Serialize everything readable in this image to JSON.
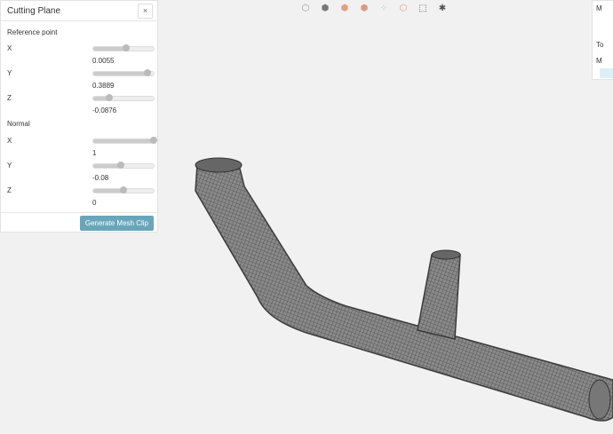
{
  "panel": {
    "title": "Cutting Plane",
    "close": "×",
    "reference_label": "Reference point",
    "reference": [
      {
        "axis": "X",
        "value": "0.0055",
        "pct": 55
      },
      {
        "axis": "Y",
        "value": "0.3889",
        "pct": 90
      },
      {
        "axis": "Z",
        "value": "-0.0876",
        "pct": 27
      }
    ],
    "normal_label": "Normal",
    "normal": [
      {
        "axis": "X",
        "value": "1",
        "pct": 100
      },
      {
        "axis": "Y",
        "value": "-0.08",
        "pct": 46
      },
      {
        "axis": "Z",
        "value": "0",
        "pct": 50
      }
    ],
    "generate": "Generate Mesh Clip"
  },
  "toolbar": [
    "cube-outline-icon",
    "cube-solid-icon",
    "cube-orange-icon",
    "cube-orange-half-icon",
    "cube-dotted-icon",
    "cube-orange-outline-icon",
    "box-select-icon",
    "settings-cube-icon"
  ],
  "right_panel": {
    "items": [
      "M",
      "To",
      "M"
    ]
  },
  "colors": {
    "accent": "#6aa6ba",
    "mesh": "#5a5a5a"
  }
}
